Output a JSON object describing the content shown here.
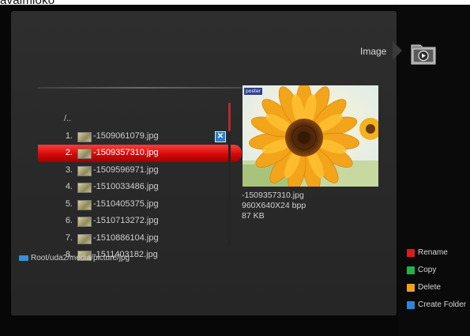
{
  "caption": "avaimioko",
  "header": {
    "mode_title": "Image"
  },
  "file_list": {
    "up_dir": "/..",
    "items": [
      {
        "num": "1.",
        "name": "-1509061079.jpg",
        "marked": true,
        "selected": false
      },
      {
        "num": "2.",
        "name": "-1509357310.jpg",
        "marked": false,
        "selected": true
      },
      {
        "num": "3.",
        "name": "-1509596971.jpg",
        "marked": false,
        "selected": false
      },
      {
        "num": "4.",
        "name": "-1510033486.jpg",
        "marked": false,
        "selected": false
      },
      {
        "num": "5.",
        "name": "-1510405375.jpg",
        "marked": false,
        "selected": false
      },
      {
        "num": "6.",
        "name": "-1510713272.jpg",
        "marked": false,
        "selected": false
      },
      {
        "num": "7.",
        "name": "-1510886104.jpg",
        "marked": false,
        "selected": false
      },
      {
        "num": "8.",
        "name": "-1511403182.jpg",
        "marked": false,
        "selected": false
      }
    ],
    "mark_glyph": "✕"
  },
  "path": "Root/uda2/media/picture/jpg",
  "preview": {
    "badge": "poster",
    "filename": "-1509357310.jpg",
    "dimensions": "960X640X24 bpp",
    "size": "87 KB"
  },
  "legend": [
    {
      "color": "#d91c1c",
      "label": "Rename"
    },
    {
      "color": "#22b14c",
      "label": "Copy"
    },
    {
      "color": "#f0a020",
      "label": "Delete"
    },
    {
      "color": "#2f86d6",
      "label": "Create Folder"
    }
  ],
  "colors": {
    "selection": "#d40a0a",
    "accent_blue": "#2d7fc4"
  }
}
